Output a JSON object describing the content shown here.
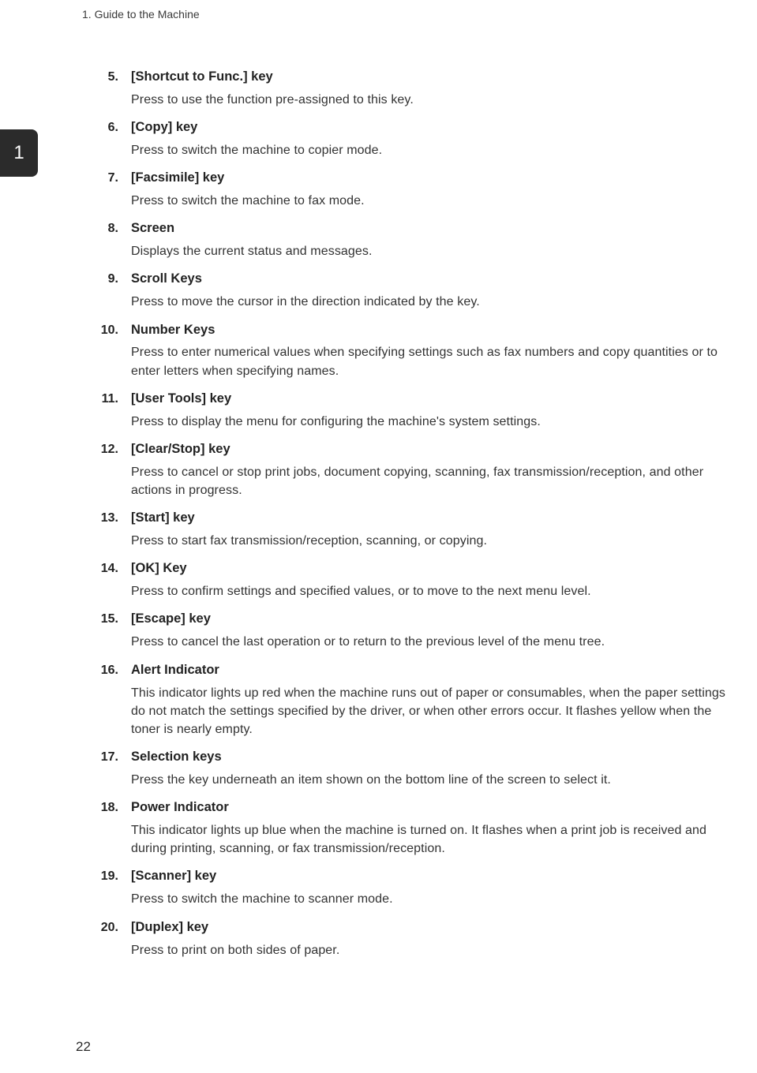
{
  "header": {
    "running_head": "1. Guide to the Machine"
  },
  "tab": {
    "label": "1"
  },
  "list": {
    "start": 5,
    "items": [
      {
        "term": "[Shortcut to Func.] key",
        "desc": "Press to use the function pre-assigned to this key."
      },
      {
        "term": "[Copy] key",
        "desc": "Press to switch the machine to copier mode."
      },
      {
        "term": "[Facsimile] key",
        "desc": "Press to switch the machine to fax mode."
      },
      {
        "term": "Screen",
        "desc": "Displays the current status and messages."
      },
      {
        "term": "Scroll Keys",
        "desc": "Press to move the cursor in the direction indicated by the key."
      },
      {
        "term": "Number Keys",
        "desc": "Press to enter numerical values when specifying settings such as fax numbers and copy quantities or to enter letters when specifying names."
      },
      {
        "term": "[User Tools] key",
        "desc": "Press to display the menu for configuring the machine's system settings."
      },
      {
        "term": "[Clear/Stop] key",
        "desc": "Press to cancel or stop print jobs, document copying, scanning, fax transmission/reception, and other actions in progress."
      },
      {
        "term": "[Start] key",
        "desc": "Press to start fax transmission/reception, scanning, or copying."
      },
      {
        "term": "[OK] Key",
        "desc": "Press to confirm settings and specified values, or to move to the next menu level."
      },
      {
        "term": "[Escape] key",
        "desc": "Press to cancel the last operation or to return to the previous level of the menu tree."
      },
      {
        "term": "Alert Indicator",
        "desc": "This indicator lights up red when the machine runs out of paper or consumables, when the paper settings do not match the settings specified by the driver, or when other errors occur. It flashes yellow when the toner is nearly empty."
      },
      {
        "term": "Selection keys",
        "desc": "Press the key underneath an item shown on the bottom line of the screen to select it."
      },
      {
        "term": "Power Indicator",
        "desc": "This indicator lights up blue when the machine is turned on. It flashes when a print job is received and during printing, scanning, or fax transmission/reception."
      },
      {
        "term": "[Scanner] key",
        "desc": "Press to switch the machine to scanner mode."
      },
      {
        "term": "[Duplex] key",
        "desc": "Press to print on both sides of paper."
      }
    ]
  },
  "footer": {
    "page_number": "22"
  }
}
